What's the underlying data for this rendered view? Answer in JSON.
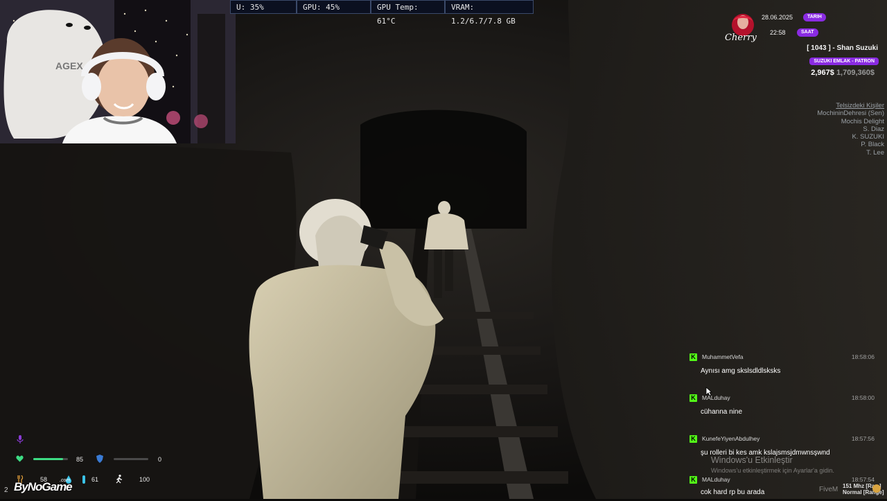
{
  "perf": {
    "cpu": "U: 35%",
    "gpu": "GPU: 45%",
    "gpu_temp": "GPU Temp: 61°C",
    "vram": "VRAM: 1.2/6.7/7.8 GB"
  },
  "hud": {
    "brand": "Cherry",
    "date": "28.06.2025",
    "date_label": "TARIH",
    "time": "22:58",
    "time_label": "SAAT",
    "player": "[ 1043 ] - Shan Suzuki",
    "job": "SUZUKI EMLAK - PATRON",
    "cash": "2,967$",
    "bank": "1,709,360$",
    "accent": "#8a2be2"
  },
  "radio": {
    "header": "Telsizdeki Kişiler",
    "members": [
      "MochininDehresi (Sen)",
      "Mochis Delight",
      "S. Diaz",
      "K. SUZUKI",
      "P. Black",
      "T. Lee"
    ]
  },
  "chat": {
    "platform_color": "#53fc18",
    "messages": [
      {
        "user": "MuhammetVefa",
        "time": "18:58:06",
        "text": "Aynısı amg skslsdldlsksks"
      },
      {
        "user": "MALduhay",
        "time": "18:58:00",
        "text": "cühanna nine"
      },
      {
        "user": "KunefeYiyenAbdulhey",
        "time": "18:57:56",
        "text": "şu rolleri bi kes amk kslajsmsjdmwnsşwnd"
      },
      {
        "user": "MALduhay",
        "time": "18:57:54",
        "text": "cok hard rp bu arada"
      }
    ]
  },
  "windows": {
    "activate": "Windows'u Etkinleştir",
    "activate_sub": "Windows'u etkinleştirmek için Ayarlar'a gidin.",
    "fivem": "FiveM",
    "hz": "151 Mhz [Ra...]",
    "normal": "Normal [Range]"
  },
  "status": {
    "health": 85,
    "health_fill": 0.85,
    "armor": 0,
    "armor_fill": 0.0,
    "hunger": 58,
    "thirst": 61,
    "stamina": 100,
    "bottom_num": "2",
    "brand": "ByNoGame",
    "brand_sub": ".com"
  }
}
